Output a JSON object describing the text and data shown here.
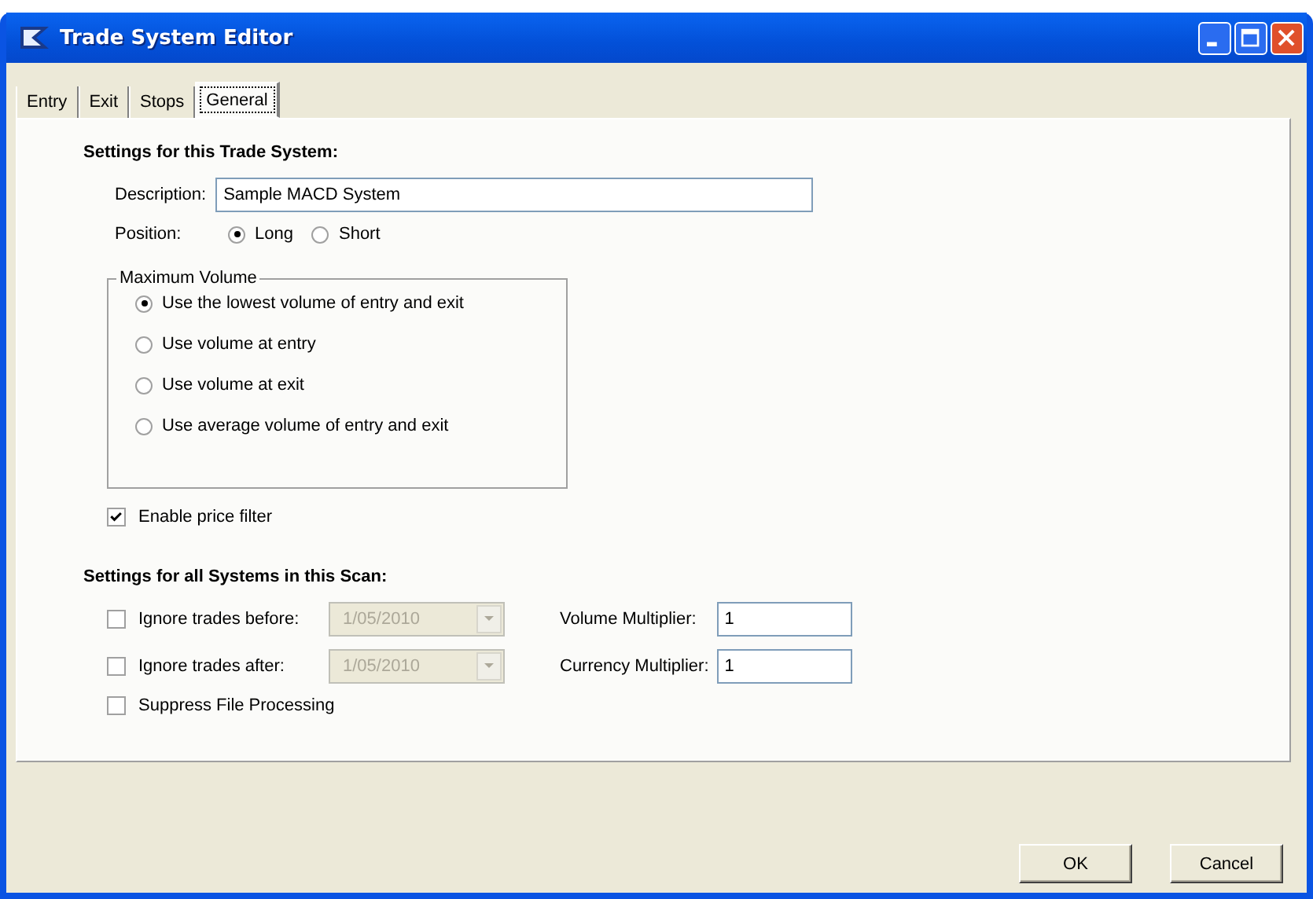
{
  "window": {
    "title": "Trade System Editor"
  },
  "tabs": [
    {
      "label": "Entry",
      "selected": false
    },
    {
      "label": "Exit",
      "selected": false
    },
    {
      "label": "Stops",
      "selected": false
    },
    {
      "label": "General",
      "selected": true
    }
  ],
  "system_settings": {
    "heading": "Settings for this Trade System:",
    "description": {
      "label": "Description:",
      "value": "Sample MACD System"
    },
    "position": {
      "label": "Position:",
      "options": [
        {
          "label": "Long",
          "selected": true
        },
        {
          "label": "Short",
          "selected": false
        }
      ]
    },
    "maximum_volume": {
      "title": "Maximum Volume",
      "options": [
        {
          "label": "Use the lowest volume of entry and exit",
          "selected": true
        },
        {
          "label": "Use volume at entry",
          "selected": false
        },
        {
          "label": "Use volume at exit",
          "selected": false
        },
        {
          "label": "Use average volume of entry and exit",
          "selected": false
        }
      ]
    },
    "price_filter": {
      "label": "Enable price filter",
      "checked": true
    }
  },
  "scan_settings": {
    "heading": "Settings for all Systems in this Scan:",
    "ignore_before": {
      "label": "Ignore trades before:",
      "checked": false,
      "date": "1/05/2010",
      "disabled": true
    },
    "ignore_after": {
      "label": "Ignore trades after:",
      "checked": false,
      "date": "1/05/2010",
      "disabled": true
    },
    "suppress_file_processing": {
      "label": "Suppress File Processing",
      "checked": false
    },
    "volume_multiplier": {
      "label": "Volume Multiplier:",
      "value": "1"
    },
    "currency_multiplier": {
      "label": "Currency Multiplier:",
      "value": "1"
    }
  },
  "buttons": [
    {
      "label": "OK"
    },
    {
      "label": "Cancel"
    }
  ]
}
